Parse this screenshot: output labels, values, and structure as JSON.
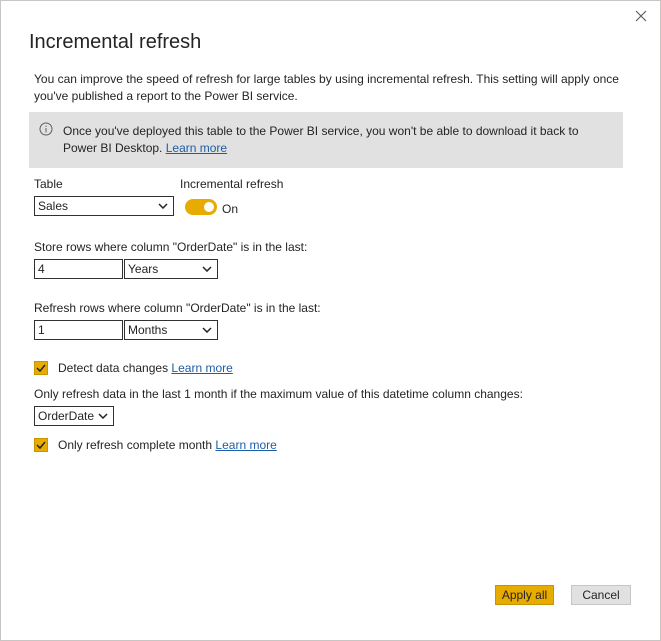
{
  "dialog": {
    "title": "Incremental refresh",
    "description": "You can improve the speed of refresh for large tables by using incremental refresh. This setting will apply once you've published a report to the Power BI service.",
    "info": {
      "text": "Once you've deployed this table to the Power BI service, you won't be able to download it back to Power BI Desktop.",
      "link": "Learn more"
    }
  },
  "table": {
    "label": "Table",
    "selected": "Sales"
  },
  "incremental": {
    "label": "Incremental refresh",
    "state": "On",
    "enabled": true
  },
  "store": {
    "label": "Store rows where column \"OrderDate\" is in the last:",
    "value": "4",
    "unit": "Years"
  },
  "refresh": {
    "label": "Refresh rows where column \"OrderDate\" is in the last:",
    "value": "1",
    "unit": "Months"
  },
  "detect": {
    "label": "Detect data changes",
    "link": "Learn more",
    "checked": true
  },
  "datetime": {
    "label": "Only refresh data in the last 1 month if the maximum value of this datetime column changes:",
    "selected": "OrderDate"
  },
  "complete": {
    "label": "Only refresh complete month",
    "link": "Learn more",
    "checked": true
  },
  "buttons": {
    "apply": "Apply all",
    "cancel": "Cancel"
  },
  "colors": {
    "accent": "#e8ab00",
    "info_bg": "#e1e1e1",
    "link": "#1d5ea8"
  },
  "icons": {
    "close": "close-icon",
    "info": "info-icon",
    "chevron": "chevron-down-icon",
    "check": "checkmark-icon"
  }
}
